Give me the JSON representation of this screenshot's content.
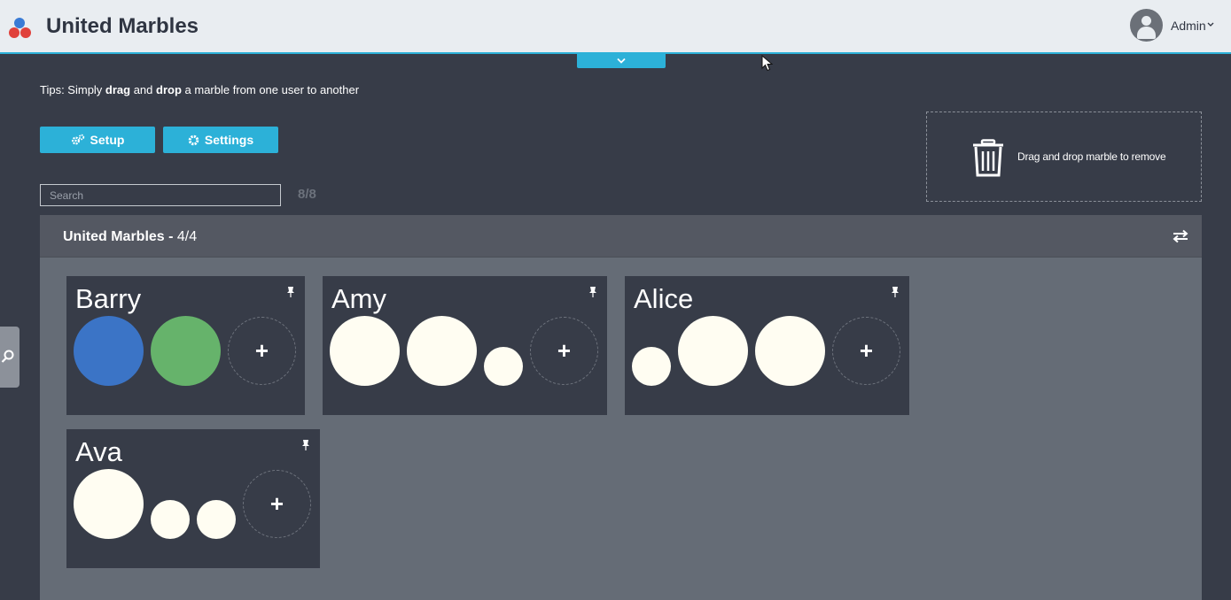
{
  "header": {
    "title": "United Marbles",
    "user": "Admin",
    "logo_colors": [
      "#3a7bd5",
      "#e0413b"
    ]
  },
  "tips": {
    "prefix": "Tips: Simply ",
    "bold1": "drag",
    "mid1": " and ",
    "bold2": "drop",
    "suffix": " a marble from one user to another"
  },
  "toolbar": {
    "setup_label": "Setup",
    "settings_label": "Settings"
  },
  "search": {
    "placeholder": "Search",
    "value": "",
    "count": "8/8"
  },
  "trash": {
    "label": "Drag and drop marble to remove"
  },
  "company": {
    "name": "United Marbles",
    "separator": " - ",
    "count": "4/4"
  },
  "colors": {
    "accent": "#2cb1d8",
    "marble_blue": "#3b74c6",
    "marble_green": "#66b36b",
    "marble_white": "#fffdf2"
  },
  "users": [
    {
      "name": "Barry",
      "add_label": "+"
    },
    {
      "name": "Amy",
      "add_label": "+"
    },
    {
      "name": "Alice",
      "add_label": "+"
    },
    {
      "name": "Ava",
      "add_label": "+"
    }
  ]
}
